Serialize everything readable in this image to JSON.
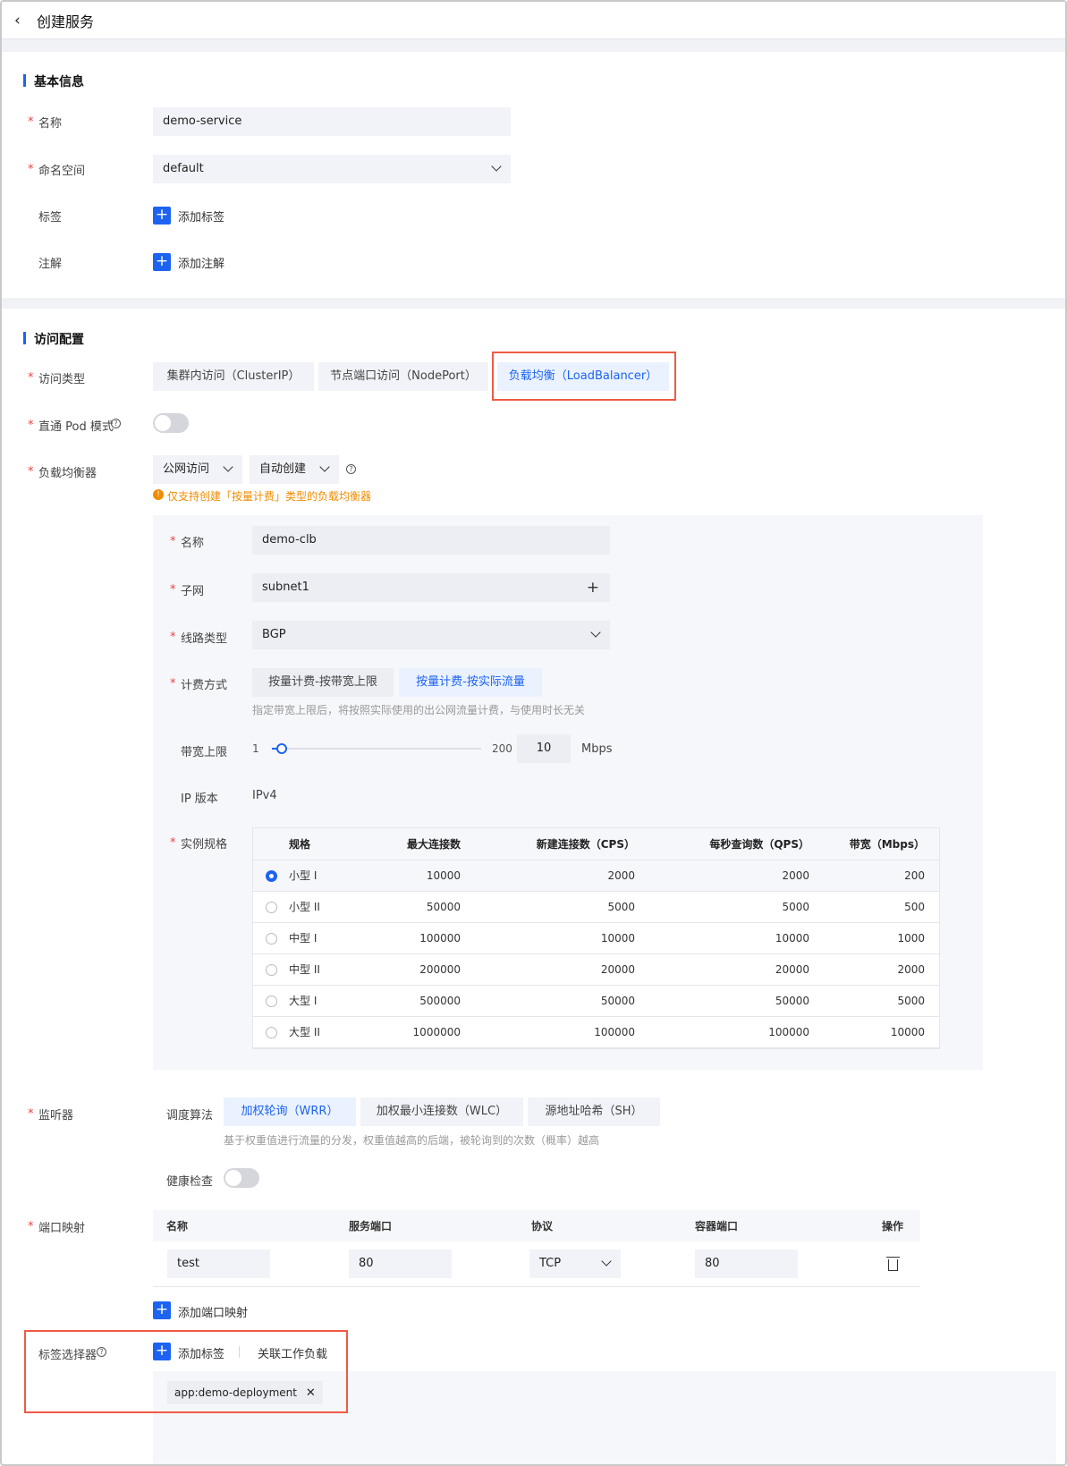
{
  "header": {
    "title": "创建服务"
  },
  "basic": {
    "section_title": "基本信息",
    "name_label": "名称",
    "name_value": "demo-service",
    "namespace_label": "命名空间",
    "namespace_value": "default",
    "labels_label": "标签",
    "add_label": "添加标签",
    "annotations_label": "注解",
    "add_annotation": "添加注解"
  },
  "access": {
    "section_title": "访问配置",
    "type_label": "访问类型",
    "types": [
      "集群内访问（ClusterIP）",
      "节点端口访问（NodePort）",
      "负载均衡（LoadBalancer）"
    ],
    "active_type": 2,
    "pod_direct_label": "直通 Pod 模式",
    "pod_direct_on": false,
    "lb_label": "负载均衡器",
    "lb_access_value": "公网访问",
    "lb_create_value": "自动创建",
    "lb_warning": "仅支持创建「按量计费」类型的负载均衡器"
  },
  "lb_form": {
    "name_label": "名称",
    "name_value": "demo-clb",
    "subnet_label": "子网",
    "subnet_value": "subnet1",
    "line_label": "线路类型",
    "line_value": "BGP",
    "billing_label": "计费方式",
    "billing_options": [
      "按量计费-按带宽上限",
      "按量计费-按实际流量"
    ],
    "billing_active": 1,
    "billing_hint": "指定带宽上限后，将按照实际使用的出公网流量计费，与使用时长无关",
    "bandwidth_label": "带宽上限",
    "bandwidth_min": "1",
    "bandwidth_max": "200",
    "bandwidth_value": "10",
    "bandwidth_fraction": 0.045,
    "bandwidth_unit": "Mbps",
    "ip_label": "IP 版本",
    "ip_value": "IPv4",
    "spec_label": "实例规格"
  },
  "spec_table": {
    "headers": [
      "规格",
      "最大连接数",
      "新建连接数（CPS）",
      "每秒查询数（QPS）",
      "带宽（Mbps）"
    ],
    "rows": [
      {
        "name": "小型 I",
        "max": "10000",
        "cps": "2000",
        "qps": "2000",
        "bw": "200",
        "selected": true
      },
      {
        "name": "小型 II",
        "max": "50000",
        "cps": "5000",
        "qps": "5000",
        "bw": "500",
        "selected": false
      },
      {
        "name": "中型 I",
        "max": "100000",
        "cps": "10000",
        "qps": "10000",
        "bw": "1000",
        "selected": false
      },
      {
        "name": "中型 II",
        "max": "200000",
        "cps": "20000",
        "qps": "20000",
        "bw": "2000",
        "selected": false
      },
      {
        "name": "大型 I",
        "max": "500000",
        "cps": "50000",
        "qps": "50000",
        "bw": "5000",
        "selected": false
      },
      {
        "name": "大型 II",
        "max": "1000000",
        "cps": "100000",
        "qps": "100000",
        "bw": "10000",
        "selected": false
      }
    ]
  },
  "listener": {
    "label": "监听器",
    "algo_label": "调度算法",
    "algos": [
      "加权轮询（WRR）",
      "加权最小连接数（WLC）",
      "源地址哈希（SH）"
    ],
    "algo_active": 0,
    "algo_hint": "基于权重值进行流量的分发，权重值越高的后端，被轮询到的次数（概率）越高",
    "health_label": "健康检查",
    "health_on": false
  },
  "ports": {
    "label": "端口映射",
    "headers": [
      "名称",
      "服务端口",
      "协议",
      "容器端口",
      "操作"
    ],
    "row": {
      "name": "test",
      "service_port": "80",
      "protocol": "TCP",
      "container_port": "80"
    },
    "add_label": "添加端口映射"
  },
  "selector": {
    "label": "标签选择器",
    "add_label": "添加标签",
    "link_workload": "关联工作负载",
    "tag": "app:demo-deployment"
  },
  "colors": {
    "primary": "#1d63f2",
    "highlight": "#ef5a45",
    "warning": "#f08c00"
  }
}
